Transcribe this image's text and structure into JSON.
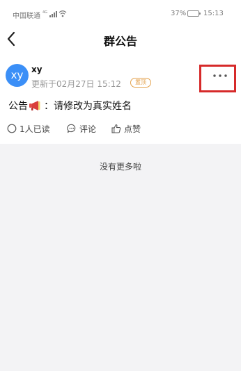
{
  "status_bar": {
    "carrier": "中国联通",
    "network": "4G",
    "battery": "37%",
    "battery_level": 0.37,
    "time": "15:13"
  },
  "header": {
    "title": "群公告",
    "back_icon": "chevron-left-icon"
  },
  "announcement": {
    "avatar_initials": "xy",
    "avatar_color": "#3b8ff7",
    "author": "xy",
    "updated": "更新于02月27日 15:12",
    "pin_badge": "置顶",
    "pin_color": "#e3a24c",
    "highlight_color": "#d62a2a",
    "more_icon": "more-horizontal-icon",
    "text_prefix": "公告",
    "text_icon": "megaphone-icon",
    "text_body": "：请修改为真实姓名",
    "actions": {
      "read": "1人已读",
      "comment": "评论",
      "like": "点赞"
    }
  },
  "footer": {
    "no_more": "没有更多啦"
  }
}
